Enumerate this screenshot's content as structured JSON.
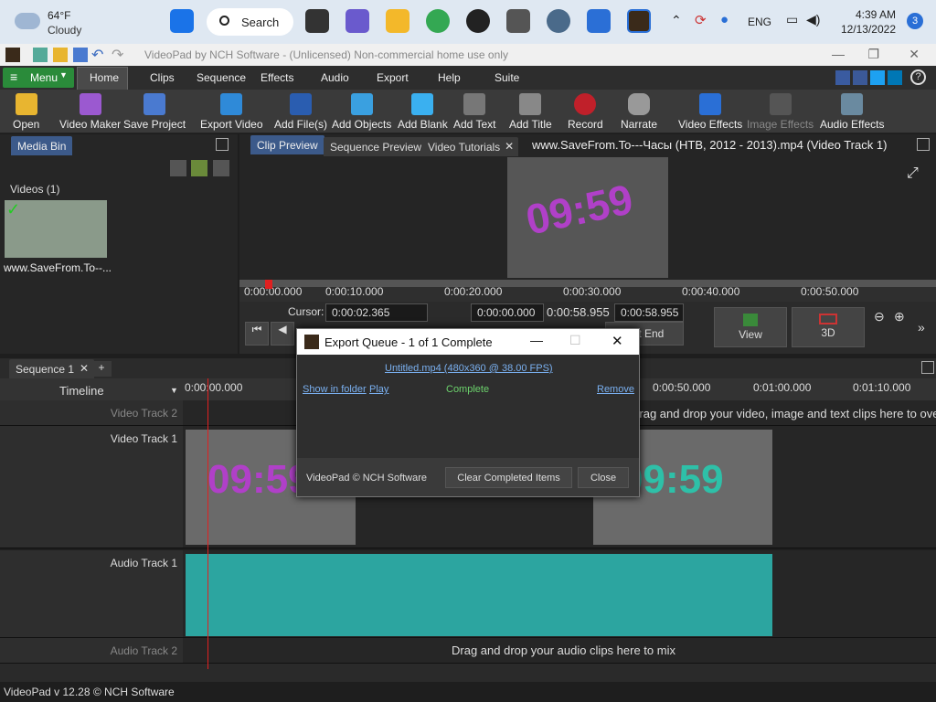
{
  "taskbar": {
    "weather_temp": "64°F",
    "weather_cond": "Cloudy",
    "search_label": "Search",
    "lang": "ENG",
    "time": "4:39 AM",
    "date": "12/13/2022",
    "notif_count": "3"
  },
  "window": {
    "title": "VideoPad by NCH Software - (Unlicensed) Non-commercial home use only"
  },
  "menu": {
    "menu_label": "Menu",
    "tabs": [
      "Home",
      "Clips",
      "Sequence",
      "Effects",
      "Audio",
      "Export",
      "Help",
      "Suite"
    ]
  },
  "toolbar": {
    "items": [
      "Open",
      "Video Maker",
      "Save Project",
      "Export Video",
      "Add File(s)",
      "Add Objects",
      "Add Blank",
      "Add Text",
      "Add Title",
      "Record",
      "Narrate",
      "Video Effects",
      "Image Effects",
      "Audio Effects"
    ]
  },
  "mediabin": {
    "tab": "Media Bin",
    "section": "Videos (1)",
    "item_name": "www.SaveFrom.To--..."
  },
  "preview": {
    "tabs": [
      "Clip Preview",
      "Sequence Preview",
      "Video Tutorials"
    ],
    "file_title": "www.SaveFrom.To---Часы (НТВ, 2012 - 2013).mp4 (Video Track 1)",
    "ruler": [
      "0:00:00.000",
      "0:00:10.000",
      "0:00:20.000",
      "0:00:30.000",
      "0:00:40.000",
      "0:00:50.000"
    ],
    "cursor_label": "Cursor:",
    "cursor_value": "0:00:02.365",
    "start_value": "0:00:00.000",
    "duration_value": "0:00:58.955",
    "end_value": "0:00:58.955",
    "set_end_label": "Set End",
    "view_label": "View",
    "mode_label": "3D"
  },
  "timeline": {
    "seq_tab": "Sequence 1",
    "timeline_label": "Timeline",
    "ruler": [
      "0:00:00.000",
      "0:00:50.000",
      "0:01:00.000",
      "0:01:10.000"
    ],
    "tracks": [
      "Video Track 2",
      "Video Track 1",
      "Audio Track 1",
      "Audio Track 2"
    ],
    "overlay_hint": "Drag and drop your video, image and text clips here to overlay",
    "audio_hint": "Drag and drop your audio clips here to mix"
  },
  "dialog": {
    "title": "Export Queue - 1 of 1 Complete",
    "file_link": "Untitled.mp4 (480x360 @ 38.00 FPS)",
    "show_in_folder": "Show in folder",
    "play": "Play",
    "status": "Complete",
    "remove": "Remove",
    "footer_text": "VideoPad © NCH Software",
    "clear_button": "Clear Completed Items",
    "close_button": "Close"
  },
  "status": {
    "version": "VideoPad v 12.28 © NCH Software"
  },
  "colors": {
    "accent_green": "#2a8b3a",
    "playhead_red": "#e02020",
    "waveform": "#2ca5a0"
  }
}
